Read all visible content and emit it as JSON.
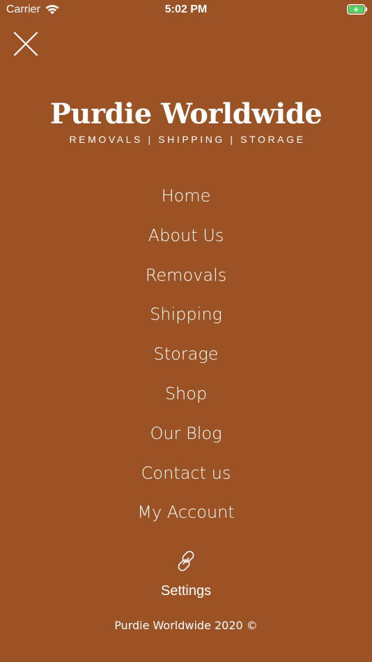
{
  "status_bar": {
    "carrier": "Carrier",
    "time": "5:02 PM",
    "battery_color": "#4cd964"
  },
  "close_button": {
    "icon": "close-icon"
  },
  "logo": {
    "title": "Purdie Worldwide",
    "tagline": "REMOVALS | SHIPPING | STORAGE"
  },
  "menu": {
    "items": [
      {
        "label": "Home"
      },
      {
        "label": "About Us"
      },
      {
        "label": "Removals"
      },
      {
        "label": "Shipping"
      },
      {
        "label": "Storage"
      },
      {
        "label": "Shop"
      },
      {
        "label": "Our Blog"
      },
      {
        "label": "Contact us"
      },
      {
        "label": "My Account"
      }
    ]
  },
  "settings": {
    "icon": "link-icon",
    "label": "Settings"
  },
  "footer": {
    "text": "Purdie Worldwide 2020 ©"
  },
  "theme": {
    "background": "#9b5225",
    "foreground": "#ffffff"
  }
}
